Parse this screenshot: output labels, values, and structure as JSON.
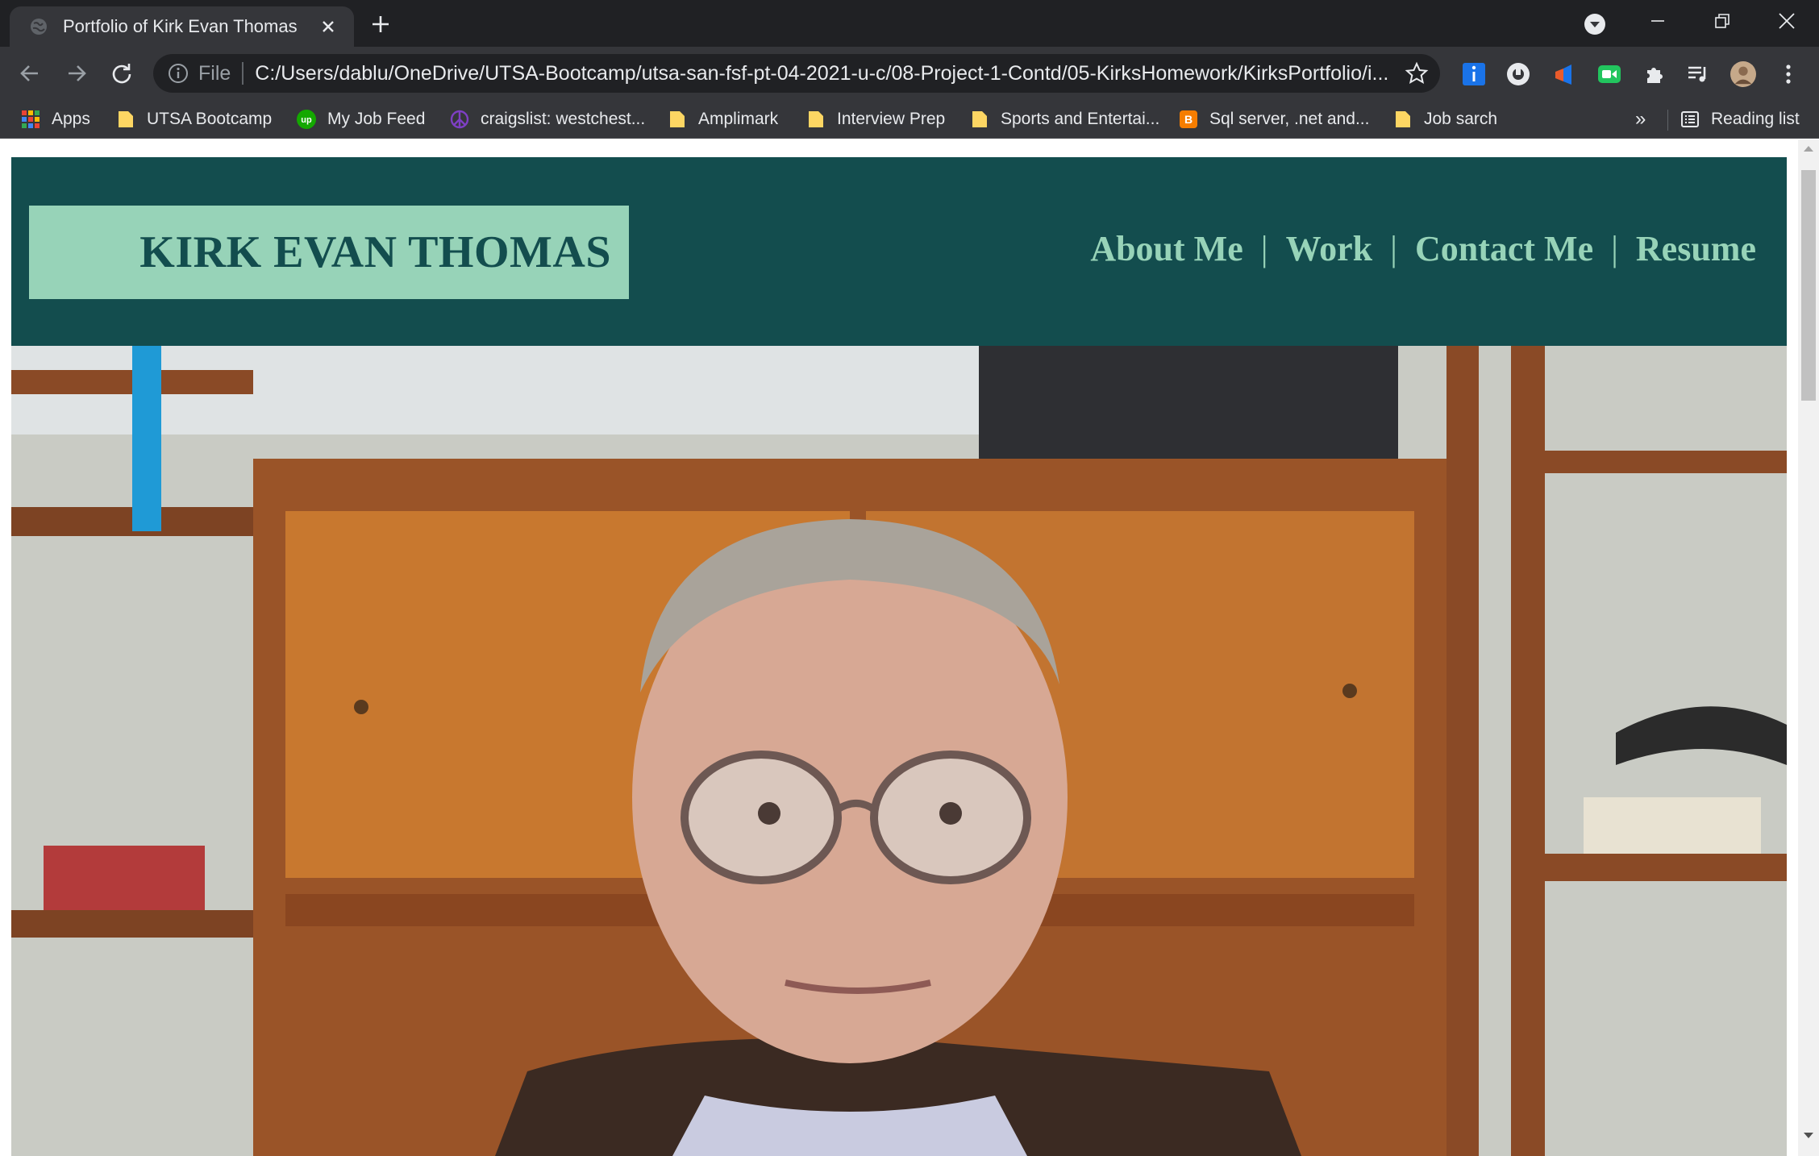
{
  "browser": {
    "tab": {
      "title": "Portfolio of Kirk Evan Thomas"
    },
    "address_bar": {
      "scheme_label": "File",
      "url": "C:/Users/dablu/OneDrive/UTSA-Bootcamp/utsa-san-fsf-pt-04-2021-u-c/08-Project-1-Contd/05-KirksHomework/KirksPortfolio/i..."
    },
    "bookmarks": [
      {
        "label": "Apps",
        "icon": "apps-grid-icon"
      },
      {
        "label": "UTSA Bootcamp",
        "icon": "folder-icon"
      },
      {
        "label": "My Job Feed",
        "icon": "upwork-icon"
      },
      {
        "label": "craigslist: westchest...",
        "icon": "craigslist-icon"
      },
      {
        "label": "Amplimark",
        "icon": "folder-icon"
      },
      {
        "label": "Interview Prep",
        "icon": "folder-icon"
      },
      {
        "label": "Sports and Entertai...",
        "icon": "folder-icon"
      },
      {
        "label": "Sql server, .net and...",
        "icon": "blogger-icon"
      },
      {
        "label": "Job sarch",
        "icon": "folder-icon"
      }
    ],
    "bookmarks_overflow": "»",
    "reading_list": "Reading list"
  },
  "page": {
    "site_name": "KIRK EVAN THOMAS",
    "nav": {
      "about": "About Me",
      "work": "Work",
      "contact": "Contact Me",
      "resume": "Resume",
      "separator": "|"
    },
    "colors": {
      "header_bg": "#134d4e",
      "name_box_bg": "#97d3b8",
      "nav_text": "#97d3b8"
    },
    "hero_photo": "portrait-photo"
  }
}
